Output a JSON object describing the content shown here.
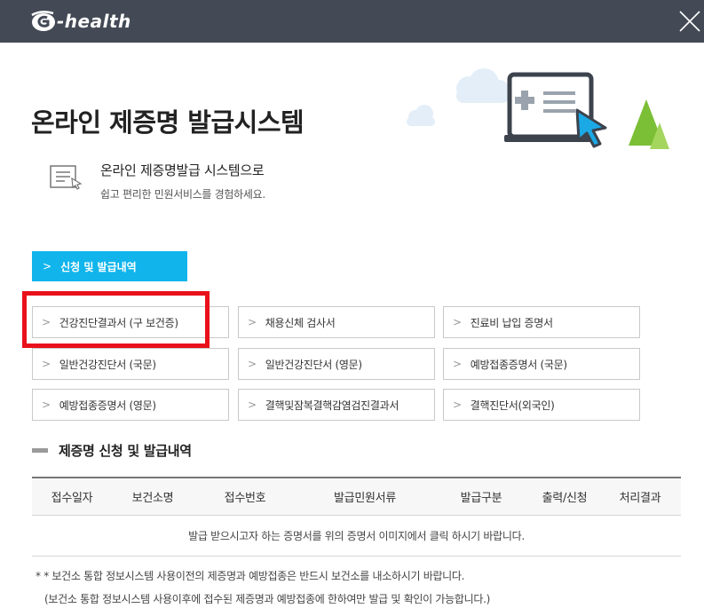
{
  "header": {
    "logo_text": "-health",
    "logo_icon": "g-logo-icon",
    "close_icon": "close-icon",
    "background": "#434a55"
  },
  "hero": {
    "title": "온라인 제증명 발급시스템",
    "illustration_icon": "computer-cursor-illustration"
  },
  "intro": {
    "icon": "document-cursor-icon",
    "title": "온라인 제증명발급 시스템으로",
    "desc": "쉽고 편리한 민원서비스를 경험하세요."
  },
  "section_tab": {
    "label": "신청 및 발급내역",
    "color": "#11b5ec"
  },
  "documents": [
    [
      "건강진단결과서 (구 보건증)",
      "채용신체 검사서",
      "진료비 납입 증명서"
    ],
    [
      "일반건강진단서 (국문)",
      "일반건강진단서 (영문)",
      "예방접종증명서 (국문)"
    ],
    [
      "예방접종증명서 (영문)",
      "결핵및잠복결핵감염검진결과서",
      "결핵진단서(외국인)"
    ]
  ],
  "highlight_color": "#e8111b",
  "history": {
    "title": "제증명 신청 및 발급내역",
    "columns": [
      "접수일자",
      "보건소명",
      "접수번호",
      "발급민원서류",
      "발급구분",
      "출력/신청",
      "처리결과"
    ],
    "empty_message": "발급 받으시고자 하는 증명서를 위의 증명서 이미지에서 클릭 하시기 바랍니다."
  },
  "notes": [
    "* * 보건소 통합 정보시스템 사용이전의 제증명과 예방접종은 반드시 보건소를 내소하시기 바랍니다.",
    "(보건소 통합 정보시스템 사용이후에 접수된 제증명과 예방접종에 한하여만 발급 및 확인이 가능합니다.)"
  ]
}
